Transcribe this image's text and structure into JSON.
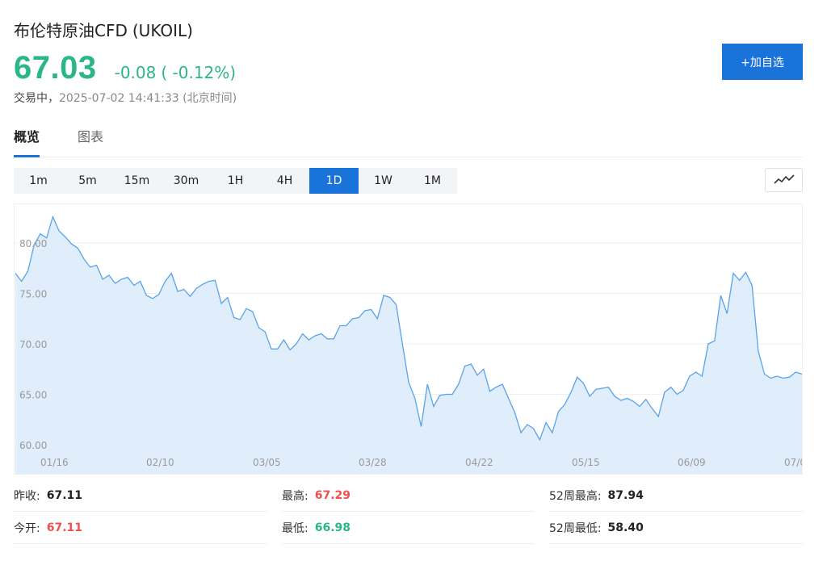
{
  "header": {
    "name": "布伦特原油CFD",
    "code": "(UKOIL)",
    "price": "67.03",
    "change": "-0.08",
    "change_pct": "( -0.12%)",
    "status": "交易中，",
    "timestamp": "2025-07-02 14:41:33",
    "timezone": "(北京时间)",
    "add_button": "+加自选",
    "color_down": "#2bb686",
    "color_up": "#f0504d",
    "accent": "#1a73d9"
  },
  "tabs": [
    {
      "label": "概览",
      "active": true
    },
    {
      "label": "图表",
      "active": false
    }
  ],
  "periods": [
    {
      "label": "1m",
      "active": false
    },
    {
      "label": "5m",
      "active": false
    },
    {
      "label": "15m",
      "active": false
    },
    {
      "label": "30m",
      "active": false
    },
    {
      "label": "1H",
      "active": false
    },
    {
      "label": "4H",
      "active": false
    },
    {
      "label": "1D",
      "active": true
    },
    {
      "label": "1W",
      "active": false
    },
    {
      "label": "1M",
      "active": false
    }
  ],
  "chart_type_icon": "line-chart-icon",
  "chart_data": {
    "type": "area",
    "y_ticks": [
      "80.00",
      "75.00",
      "70.00",
      "65.00",
      "60.00"
    ],
    "x_ticks": [
      "01/16",
      "02/10",
      "03/05",
      "03/28",
      "04/22",
      "05/15",
      "06/09",
      "07/0"
    ],
    "ylim": [
      58.0,
      82.5
    ],
    "grid": true,
    "line_color": "#5aa3e8",
    "fill_color": "#e0eefb",
    "values": [
      77.0,
      76.2,
      77.2,
      79.8,
      80.9,
      80.5,
      82.6,
      81.2,
      80.6,
      79.9,
      79.5,
      78.4,
      77.6,
      77.8,
      76.4,
      76.8,
      76.0,
      76.4,
      76.6,
      75.8,
      76.2,
      74.8,
      74.5,
      74.9,
      76.2,
      77.0,
      75.2,
      75.4,
      74.7,
      75.5,
      75.9,
      76.2,
      76.3,
      74.0,
      74.6,
      72.6,
      72.4,
      73.5,
      73.2,
      71.6,
      71.2,
      69.5,
      69.5,
      70.4,
      69.4,
      70.0,
      71.0,
      70.4,
      70.8,
      71.0,
      70.5,
      70.5,
      71.8,
      71.8,
      72.5,
      72.6,
      73.3,
      73.4,
      72.5,
      74.8,
      74.6,
      73.9,
      70.0,
      66.2,
      64.6,
      61.8,
      66.0,
      63.8,
      64.9,
      65.0,
      65.0,
      66.0,
      67.8,
      68.0,
      66.9,
      67.5,
      65.3,
      65.7,
      66.0,
      64.6,
      63.2,
      61.2,
      62.0,
      61.6,
      60.5,
      62.2,
      61.2,
      63.3,
      64.0,
      65.2,
      66.7,
      66.1,
      64.8,
      65.5,
      65.6,
      65.7,
      64.8,
      64.4,
      64.6,
      64.3,
      63.8,
      64.5,
      63.6,
      62.8,
      65.2,
      65.7,
      65.0,
      65.4,
      66.8,
      67.2,
      66.8,
      70.0,
      70.3,
      74.8,
      73.0,
      77.0,
      76.3,
      77.1,
      75.8,
      69.3,
      67.0,
      66.6,
      66.8,
      66.6,
      66.7,
      67.2,
      67.0
    ]
  },
  "stats": [
    {
      "label": "昨收:",
      "value": "67.11",
      "tone": "neutral"
    },
    {
      "label": "最高:",
      "value": "67.29",
      "tone": "up"
    },
    {
      "label": "52周最高:",
      "value": "87.94",
      "tone": "neutral"
    },
    {
      "label": "今开:",
      "value": "67.11",
      "tone": "up"
    },
    {
      "label": "最低:",
      "value": "66.98",
      "tone": "down"
    },
    {
      "label": "52周最低:",
      "value": "58.40",
      "tone": "neutral"
    }
  ]
}
